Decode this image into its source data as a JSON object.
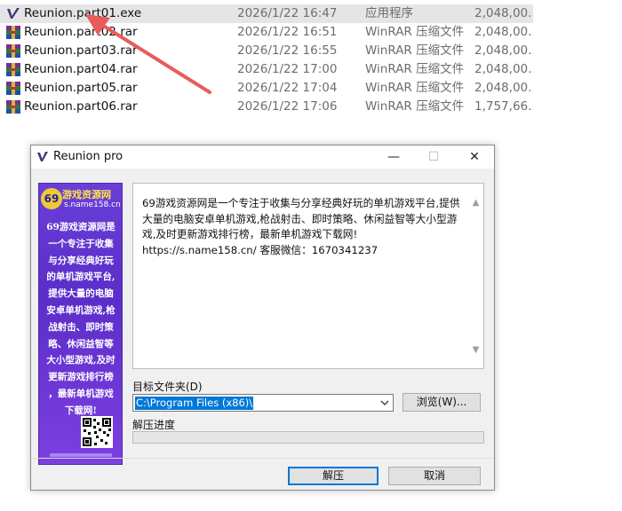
{
  "files": [
    {
      "name": "Reunion.part01.exe",
      "date": "2026/1/22 16:47",
      "type": "应用程序",
      "size": "2,048,00...",
      "icon": "app-exe-icon",
      "selected": true
    },
    {
      "name": "Reunion.part02.rar",
      "date": "2026/1/22 16:51",
      "type": "WinRAR 压缩文件",
      "size": "2,048,00...",
      "icon": "winrar-icon"
    },
    {
      "name": "Reunion.part03.rar",
      "date": "2026/1/22 16:55",
      "type": "WinRAR 压缩文件",
      "size": "2,048,00...",
      "icon": "winrar-icon"
    },
    {
      "name": "Reunion.part04.rar",
      "date": "2026/1/22 17:00",
      "type": "WinRAR 压缩文件",
      "size": "2,048,00...",
      "icon": "winrar-icon"
    },
    {
      "name": "Reunion.part05.rar",
      "date": "2026/1/22 17:04",
      "type": "WinRAR 压缩文件",
      "size": "2,048,00...",
      "icon": "winrar-icon"
    },
    {
      "name": "Reunion.part06.rar",
      "date": "2026/1/22 17:06",
      "type": "WinRAR 压缩文件",
      "size": "1,757,66...",
      "icon": "winrar-icon"
    }
  ],
  "annotation": {
    "color": "#e85c5c",
    "icon": "red-arrow-annotation"
  },
  "dialog": {
    "title": "Reunion  pro",
    "minimize_glyph": "—",
    "maximize_glyph": "☐",
    "close_glyph": "✕",
    "ad": {
      "logo_number": "69",
      "brand": "游戏资源网",
      "domain": "s.name158.cn",
      "lines": [
        "69游戏资源网是",
        "一个专注于收集",
        "与分享经典好玩",
        "的单机游戏平台,",
        "提供大量的电脑",
        "安卓单机游戏,枪",
        "战射击、即时策",
        "略、休闲益智等",
        "大小型游戏,及时",
        "更新游戏排行榜",
        "，最新单机游戏",
        "下载网!"
      ]
    },
    "info_text": "69游戏资源网是一个专注于收集与分享经典好玩的单机游戏平台,提供大量的电脑安卓单机游戏,枪战射击、即时策略、休闲益智等大小型游戏,及时更新游戏排行榜，最新单机游戏下载网!\nhttps://s.name158.cn/ 客服微信：1670341237",
    "dest_label": "目标文件夹(D)",
    "dest_value": "C:\\Program Files (x86)\\",
    "browse_label": "浏览(W)...",
    "progress_label": "解压进度",
    "progress_value": 0,
    "ok_label": "解压",
    "cancel_label": "取消",
    "colors": {
      "accent": "#0078d7",
      "ad_bg": "#6a3fd8"
    }
  }
}
